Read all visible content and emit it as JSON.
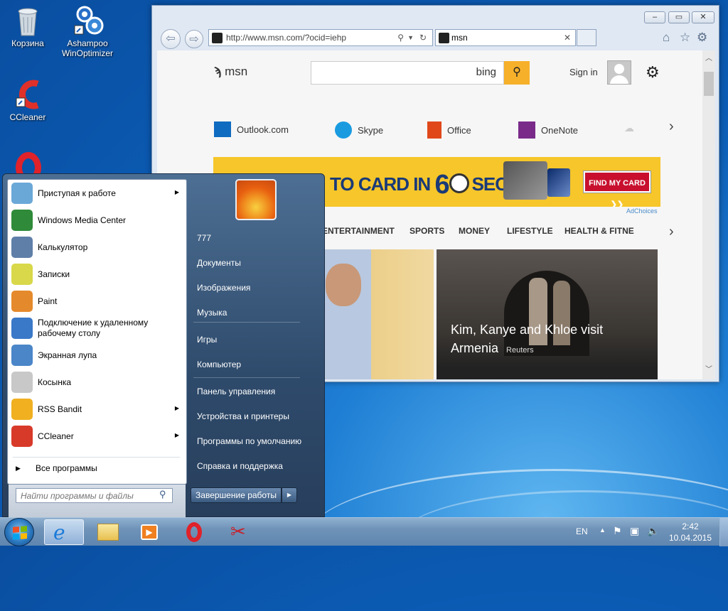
{
  "desktop": {
    "icons": [
      {
        "label": "Корзина"
      },
      {
        "label": "Ashampoo WinOptimizer"
      },
      {
        "label": "CCleaner"
      }
    ]
  },
  "browser": {
    "address": "http://www.msn.com/?ocid=iehp",
    "tab_title": "msn",
    "msn": {
      "logo": "msn",
      "bing": "bing",
      "sign_in": "Sign in",
      "apps": [
        "Outlook.com",
        "Skype",
        "Office",
        "OneNote"
      ],
      "ad_text_1": "TO CARD IN",
      "ad_text_2": "6",
      "ad_text_3": "SECONDS",
      "ad_tm": "SM",
      "ad_button": "FIND MY CARD ❯❯",
      "adchoices": "AdChoices",
      "nav": [
        "ENTERTAINMENT",
        "SPORTS",
        "MONEY",
        "LIFESTYLE",
        "HEALTH & FITNE"
      ],
      "headline": "Kim, Kanye and Khloe visit Armenia",
      "source": "Reuters"
    }
  },
  "start_menu": {
    "programs": [
      {
        "label": "Приступая к работе",
        "arrow": true,
        "color": "#6aa8d8"
      },
      {
        "label": "Windows Media Center",
        "arrow": false,
        "color": "#2f8a3a"
      },
      {
        "label": "Калькулятор",
        "arrow": false,
        "color": "#5f7fa8"
      },
      {
        "label": "Записки",
        "arrow": false,
        "color": "#d8d84a"
      },
      {
        "label": "Paint",
        "arrow": false,
        "color": "#e58a2c"
      },
      {
        "label": "Подключение к удаленному рабочему столу",
        "arrow": false,
        "color": "#3a78c8"
      },
      {
        "label": "Экранная лупа",
        "arrow": false,
        "color": "#4a86c8"
      },
      {
        "label": "Косынка",
        "arrow": false,
        "color": "#c8c8c8"
      },
      {
        "label": "RSS Bandit",
        "arrow": true,
        "color": "#f0b020"
      },
      {
        "label": "CCleaner",
        "arrow": true,
        "color": "#d83a2a"
      }
    ],
    "all_programs": "Все программы",
    "search_placeholder": "Найти программы и файлы",
    "user": "777",
    "right_items": [
      "Документы",
      "Изображения",
      "Музыка",
      "Игры",
      "Компьютер",
      "Панель управления",
      "Устройства и принтеры",
      "Программы по умолчанию",
      "Справка и поддержка"
    ],
    "shutdown": "Завершение работы"
  },
  "taskbar": {
    "lang": "EN",
    "time": "2:42",
    "date": "10.04.2015"
  }
}
